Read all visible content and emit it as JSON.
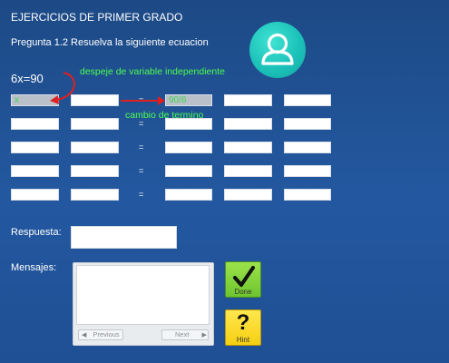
{
  "header": {
    "title": "EJERCICIOS DE PRIMER GRADO",
    "question": "Pregunta 1.2 Resuelva la siguiente ecuacion"
  },
  "equation": "6x=90",
  "annotations": {
    "despeje": "despeje de variable independiente",
    "cambio": "cambio de termino"
  },
  "grid": {
    "equals_sign": "=",
    "rows": [
      [
        "x",
        "",
        "90/6",
        "",
        ""
      ],
      [
        "",
        "",
        "",
        "",
        ""
      ],
      [
        "",
        "",
        "",
        "",
        ""
      ],
      [
        "",
        "",
        "",
        "",
        ""
      ],
      [
        "",
        "",
        "",
        "",
        ""
      ]
    ]
  },
  "answer": {
    "label": "Respuesta:",
    "value": ""
  },
  "messages": {
    "label": "Mensajes:",
    "content": "",
    "previous_label": "Previous",
    "next_label": "Next"
  },
  "buttons": {
    "done_label": "Done",
    "hint_label": "Hint",
    "hint_symbol": "?"
  },
  "colors": {
    "background": "#2358a0",
    "annotation_green": "#4dff4d",
    "avatar_teal": "#1cc2b9",
    "arrow_red": "#e02020",
    "done_green": "#7ed23a",
    "hint_yellow": "#f9d91e"
  },
  "icons": {
    "avatar": "user-icon",
    "done": "check-icon",
    "hint": "question-icon",
    "prev_arrow": "triangle-left-icon",
    "next_arrow": "triangle-right-icon"
  }
}
